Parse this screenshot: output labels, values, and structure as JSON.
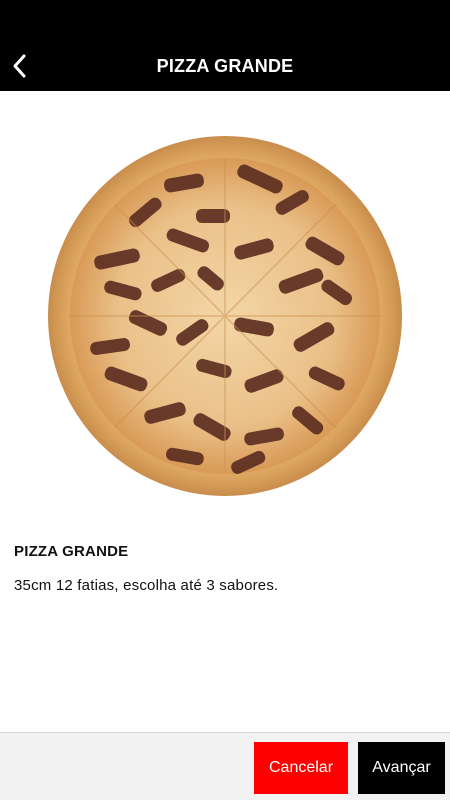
{
  "header": {
    "title": "PIZZA GRANDE",
    "back_icon": "chevron-left-icon"
  },
  "product": {
    "image_alt": "pizza",
    "name": "PIZZA GRANDE",
    "description": "35cm 12 fatias, escolha até 3 sabores."
  },
  "footer": {
    "cancel_label": "Cancelar",
    "next_label": "Avançar"
  },
  "colors": {
    "header_bg": "#000000",
    "cancel_bg": "#ff0000",
    "next_bg": "#000000",
    "footer_bg": "#f2f2f2"
  }
}
